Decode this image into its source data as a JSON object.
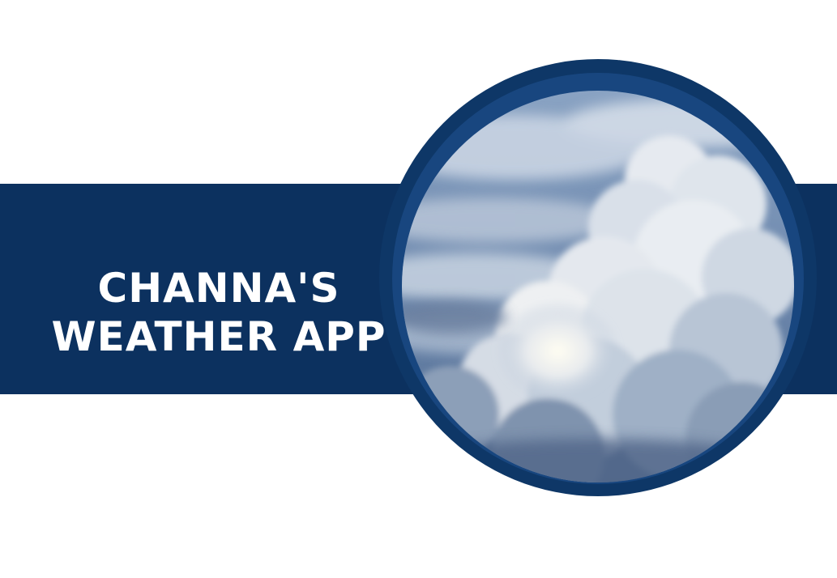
{
  "title": {
    "line1": "Channa's",
    "line2": "Weather App"
  },
  "image": {
    "subject": "cumulus-clouds-photo"
  },
  "colors": {
    "band": "#0c315f",
    "ring_outer": "#0e3767",
    "ring_inner": "#18467f",
    "text": "#ffffff",
    "sky": "#6d88ad"
  }
}
